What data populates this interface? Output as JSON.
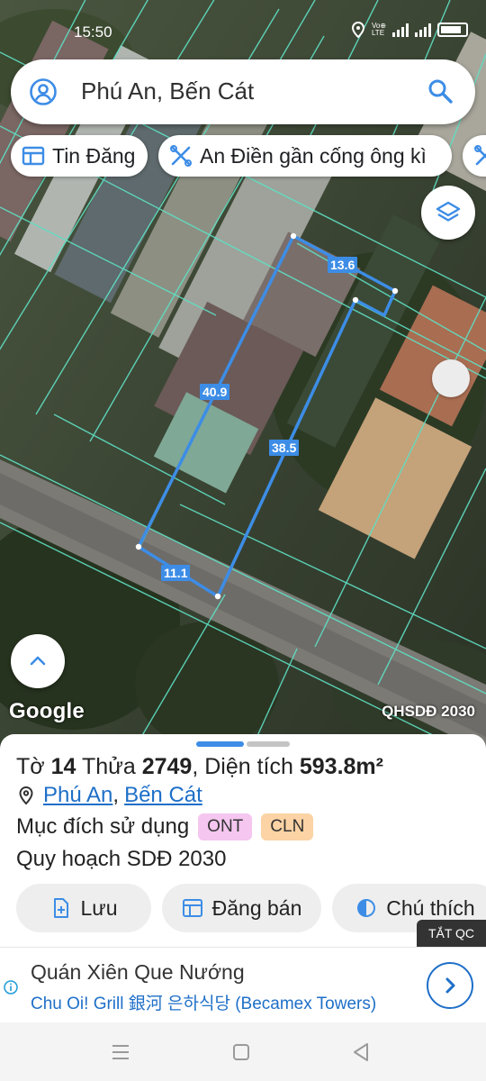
{
  "status_bar": {
    "time": "15:50",
    "battery": "76"
  },
  "search": {
    "query": "Phú An, Bến Cát"
  },
  "chips": [
    {
      "label": "Tin Đăng"
    },
    {
      "label": "An Điền gần cống ông kì"
    },
    {
      "label": ""
    }
  ],
  "map": {
    "dimensions": {
      "top": "13.6",
      "left": "40.9",
      "right": "38.5",
      "bottom": "11.1"
    },
    "attribution": "Google",
    "layer_label": "QHSDĐ 2030"
  },
  "parcel": {
    "prefix_to": "Tờ",
    "to_number": "14",
    "prefix_thua": "Thửa",
    "thua_number": "2749",
    "area_label": ", Diện tích",
    "area_value": "593.8m²",
    "ward": "Phú An",
    "district": "Bến Cát",
    "separator": ",",
    "purpose_label": "Mục đích sử dụng",
    "purpose_tags": [
      "ONT",
      "CLN"
    ],
    "plan_label": "Quy hoạch SDĐ 2030"
  },
  "actions": [
    {
      "label": "Lưu"
    },
    {
      "label": "Đăng bán"
    },
    {
      "label": "Chú thích"
    }
  ],
  "ad": {
    "close_label": "TẮT QC",
    "title": "Quán Xiên Que Nướng",
    "subtitle": "Chu Oi! Grill 銀河 은하식당 (Becamex Towers)"
  },
  "colors": {
    "accent": "#3d8de6",
    "link": "#1e6fc8",
    "parcel_line": "#3d8de6",
    "cadastral_line": "#5fe0c4",
    "tag_ont": "#f5c6ef",
    "tag_cln": "#fbd3a4"
  }
}
